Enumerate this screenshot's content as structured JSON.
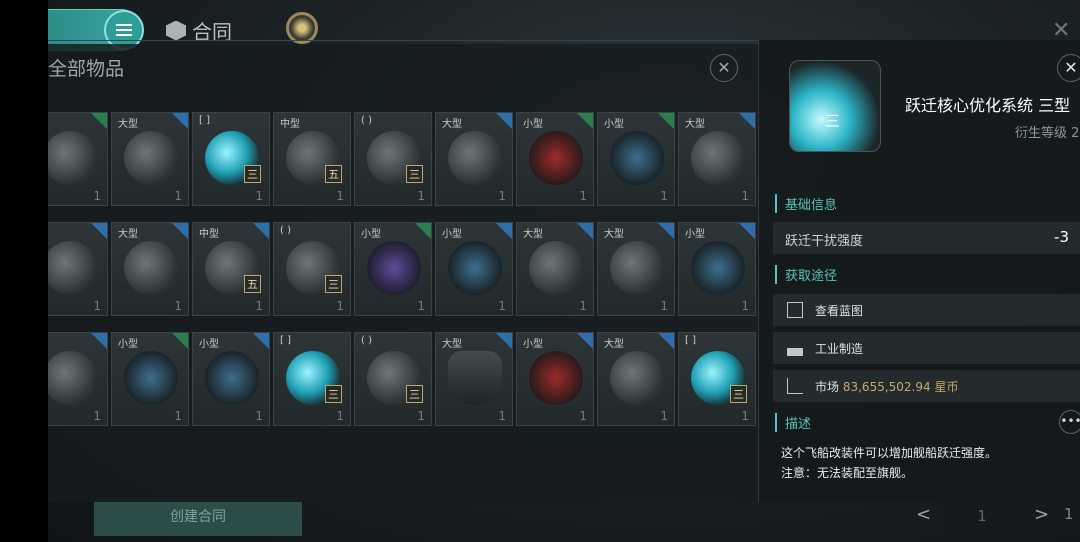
{
  "topbar": {
    "contract_tab": "合同"
  },
  "inventory": {
    "title": "全部物品",
    "rows": [
      [
        {
          "size": "",
          "tier": "",
          "qty": "1",
          "pict": "turret",
          "corner": "green"
        },
        {
          "size": "大型",
          "tier": "",
          "qty": "1",
          "pict": "turret",
          "corner": "blue"
        },
        {
          "size": "[ ]",
          "tier": "三",
          "qty": "1",
          "pict": "orb",
          "corner": ""
        },
        {
          "size": "中型",
          "tier": "五",
          "qty": "1",
          "pict": "turret",
          "corner": ""
        },
        {
          "size": "( )",
          "tier": "三",
          "qty": "1",
          "pict": "turret",
          "corner": ""
        },
        {
          "size": "大型",
          "tier": "",
          "qty": "1",
          "pict": "turret",
          "corner": "blue"
        },
        {
          "size": "小型",
          "tier": "",
          "qty": "1",
          "pict": "red",
          "corner": "green"
        },
        {
          "size": "小型",
          "tier": "",
          "qty": "1",
          "pict": "blue",
          "corner": "green"
        },
        {
          "size": "大型",
          "tier": "",
          "qty": "1",
          "pict": "turret",
          "corner": "blue"
        }
      ],
      [
        {
          "size": "",
          "tier": "",
          "qty": "1",
          "pict": "turret",
          "corner": "blue"
        },
        {
          "size": "大型",
          "tier": "",
          "qty": "1",
          "pict": "turret",
          "corner": "blue"
        },
        {
          "size": "中型",
          "tier": "五",
          "qty": "1",
          "pict": "turret",
          "corner": "blue"
        },
        {
          "size": "( )",
          "tier": "三",
          "qty": "1",
          "pict": "turret",
          "corner": ""
        },
        {
          "size": "小型",
          "tier": "",
          "qty": "1",
          "pict": "purple",
          "corner": "green"
        },
        {
          "size": "小型",
          "tier": "",
          "qty": "1",
          "pict": "blue",
          "corner": "blue"
        },
        {
          "size": "大型",
          "tier": "",
          "qty": "1",
          "pict": "turret",
          "corner": "blue"
        },
        {
          "size": "大型",
          "tier": "",
          "qty": "1",
          "pict": "turret",
          "corner": "blue"
        },
        {
          "size": "小型",
          "tier": "",
          "qty": "1",
          "pict": "blue",
          "corner": "blue"
        }
      ],
      [
        {
          "size": "",
          "tier": "",
          "qty": "1",
          "pict": "turret",
          "corner": "blue"
        },
        {
          "size": "小型",
          "tier": "",
          "qty": "1",
          "pict": "blue",
          "corner": "green"
        },
        {
          "size": "小型",
          "tier": "",
          "qty": "1",
          "pict": "blue",
          "corner": "blue"
        },
        {
          "size": "[ ]",
          "tier": "三",
          "qty": "1",
          "pict": "orb",
          "corner": ""
        },
        {
          "size": "( )",
          "tier": "三",
          "qty": "1",
          "pict": "turret",
          "corner": ""
        },
        {
          "size": "大型",
          "tier": "",
          "qty": "1",
          "pict": "shield",
          "corner": "blue"
        },
        {
          "size": "小型",
          "tier": "",
          "qty": "1",
          "pict": "red",
          "corner": "blue"
        },
        {
          "size": "大型",
          "tier": "",
          "qty": "1",
          "pict": "turret",
          "corner": "blue"
        },
        {
          "size": "[ ]",
          "tier": "三",
          "qty": "1",
          "pict": "orb",
          "corner": ""
        }
      ]
    ]
  },
  "footer": {
    "create_contract": "创建合同",
    "page": "1",
    "end_label": "1"
  },
  "detail": {
    "name": "跃迁核心优化系统 三型",
    "tier": "三",
    "level_label": "衍生等级 2",
    "section_basic": "基础信息",
    "stat_label": "跃迁干扰强度",
    "stat_value": "-3",
    "section_source": "获取途径",
    "source_blueprint": "查看蓝图",
    "source_industry": "工业制造",
    "market_label": "市场",
    "market_price": "83,655,502.94 星币",
    "section_desc": "描述",
    "desc_line1": "这个飞船改装件可以增加舰船跃迁强度。",
    "desc_line2": "注意：无法装配至旗舰。"
  }
}
